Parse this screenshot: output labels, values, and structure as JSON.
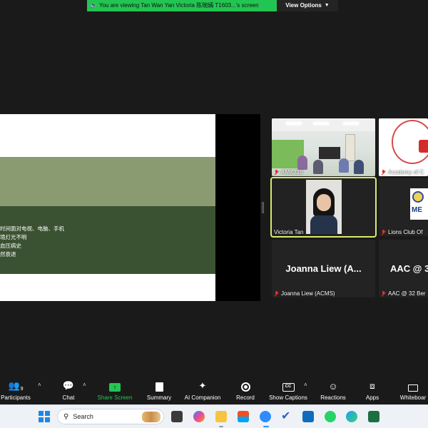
{
  "banner": {
    "viewing_text": "You are viewing Tan Wan Yan Victoria 陈琬嫣 T1603...'s screen",
    "view_options_label": "View Options"
  },
  "shared_screen": {
    "lines": [
      "时间面对电视、电脑、手机",
      "境灯光不明",
      "血压病史",
      "然衰退"
    ]
  },
  "tiles": [
    {
      "id": "amk318",
      "name": "AMK318",
      "muted": true
    },
    {
      "id": "academy",
      "name": "Academy of C",
      "muted": true
    },
    {
      "id": "victoria",
      "name": "Victoria Tan",
      "muted": false,
      "active_speaker": true
    },
    {
      "id": "lions",
      "name": "Lions Club Of",
      "muted": true,
      "logo_text": "ME"
    },
    {
      "id": "joanna",
      "name": "Joanna Liew (ACMS)",
      "display_name": "Joanna Liew (A...",
      "muted": true
    },
    {
      "id": "aac",
      "name": "AAC @ 32 Ber",
      "display_name": "AAC @ 3",
      "muted": true
    }
  ],
  "toolbar": {
    "participants_label": "Participants",
    "participants_count": "9",
    "chat_label": "Chat",
    "share_label": "Share Screen",
    "summary_label": "Summary",
    "ai_label": "AI Companion",
    "record_label": "Record",
    "captions_label": "Show Captions",
    "reactions_label": "Reactions",
    "apps_label": "Apps",
    "whiteboards_label": "Whiteboar"
  },
  "taskbar": {
    "search_placeholder": "Search",
    "apps": [
      "file-explorer-icon",
      "copilot-icon",
      "explorer-folder-icon",
      "store-icon",
      "zoom-icon",
      "todo-icon",
      "outlook-icon",
      "whatsapp-icon",
      "edge-icon",
      "excel-icon"
    ]
  },
  "colors": {
    "accent_green": "#23c552",
    "active_speaker": "#d8eb6e",
    "muted_red": "#e03030"
  }
}
